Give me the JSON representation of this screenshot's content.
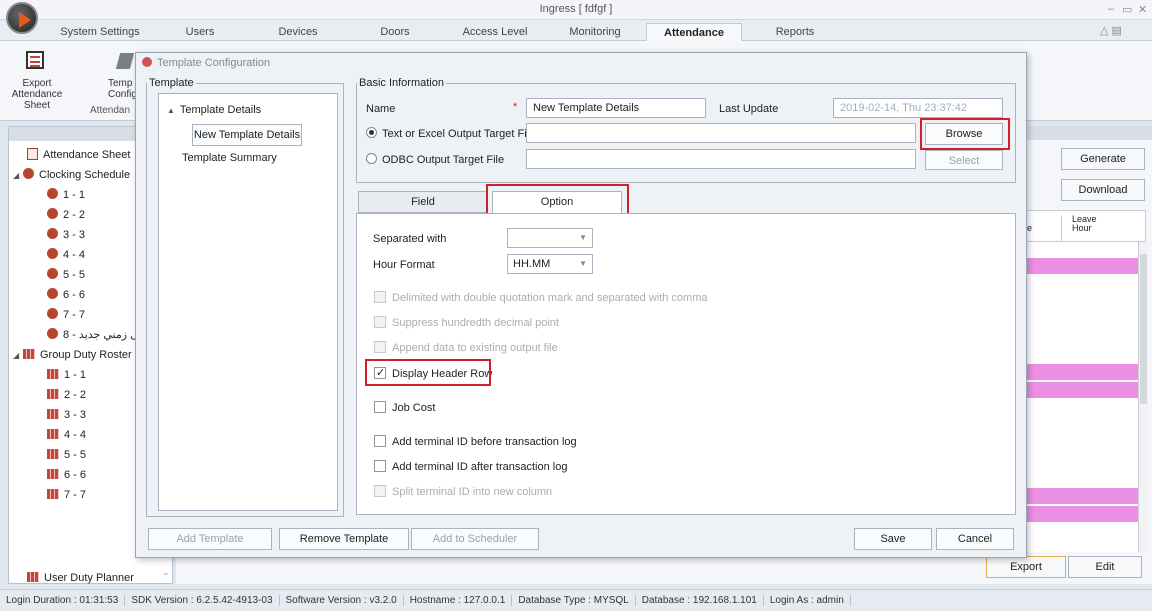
{
  "window": {
    "title": "Ingress [ fdfgf ]"
  },
  "tabs": [
    "System Settings",
    "Users",
    "Devices",
    "Doors",
    "Access Level",
    "Monitoring",
    "Attendance",
    "Reports"
  ],
  "active_tab": "Attendance",
  "ribbon": {
    "export_label_1": "Export Attendance",
    "export_label_2": "Sheet",
    "templ_label_1": "Temp",
    "templ_label_2": "Config",
    "group_label": "Attendan"
  },
  "tree": {
    "attendance_sheet": "Attendance Sheet",
    "clocking": "Clocking Schedule",
    "clocking_items": [
      "1 - 1",
      "2 - 2",
      "3 - 3",
      "4 - 4",
      "5 - 5",
      "6 - 6",
      "7 - 7",
      "8 - ل زمني جديد"
    ],
    "group": "Group Duty Roster",
    "group_items": [
      "1 - 1",
      "2 - 2",
      "3 - 3",
      "4 - 4",
      "5 - 5",
      "6 - 6",
      "7 - 7"
    ],
    "user_duty": "User Duty Planner"
  },
  "right": {
    "generate": "Generate",
    "download": "Download",
    "col_leave_1": "Leave",
    "col_leave_2": "Hour",
    "col_e": "e",
    "export": "Export",
    "edit": "Edit"
  },
  "dialog": {
    "title": "Template Configuration",
    "template_group": "Template",
    "template_details": "Template Details",
    "new_template": "New Template Details",
    "template_summary": "Template Summary",
    "basic_group": "Basic Information",
    "name_label": "Name",
    "required_mark": "*",
    "name_value": "New Template Details",
    "last_update_label": "Last Update",
    "last_update_value": "2019-02-14, Thu  23:37:42",
    "text_excel": "Text or Excel Output Target File",
    "odbc": "ODBC Output Target File",
    "browse": "Browse",
    "select": "Select",
    "tab_field": "Field",
    "tab_option": "Option",
    "separated_label": "Separated with",
    "separated_value": "",
    "hour_format_label": "Hour Format",
    "hour_format_value": "HH.MM",
    "options": [
      {
        "label": "Delimited with double quotation mark and separated with comma",
        "checked": false,
        "disabled": true
      },
      {
        "label": "Suppress hundredth decimal point",
        "checked": false,
        "disabled": true
      },
      {
        "label": "Append data to existing output file",
        "checked": false,
        "disabled": true
      },
      {
        "label": "Display Header Row",
        "checked": true,
        "disabled": false
      },
      {
        "label": "Job Cost",
        "checked": false,
        "disabled": false
      },
      {
        "label": "Add terminal ID before transaction log",
        "checked": false,
        "disabled": false
      },
      {
        "label": "Add terminal ID after transaction log",
        "checked": false,
        "disabled": false
      },
      {
        "label": "Split terminal ID into new column",
        "checked": false,
        "disabled": true
      }
    ],
    "add_template": "Add Template",
    "remove_template": "Remove Template",
    "add_scheduler": "Add to Scheduler",
    "save": "Save",
    "cancel": "Cancel"
  },
  "status": [
    "Login Duration : 01:31:53",
    "SDK Version : 6.2.5.42-4913-03",
    "Software Version : v3.2.0",
    "Hostname : 127.0.0.1",
    "Database Type : MYSQL",
    "Database : 192.168.1.101",
    "Login As : admin"
  ],
  "colors": {
    "highlight": "#d0202a",
    "pink_row": "#ec8fe6"
  }
}
